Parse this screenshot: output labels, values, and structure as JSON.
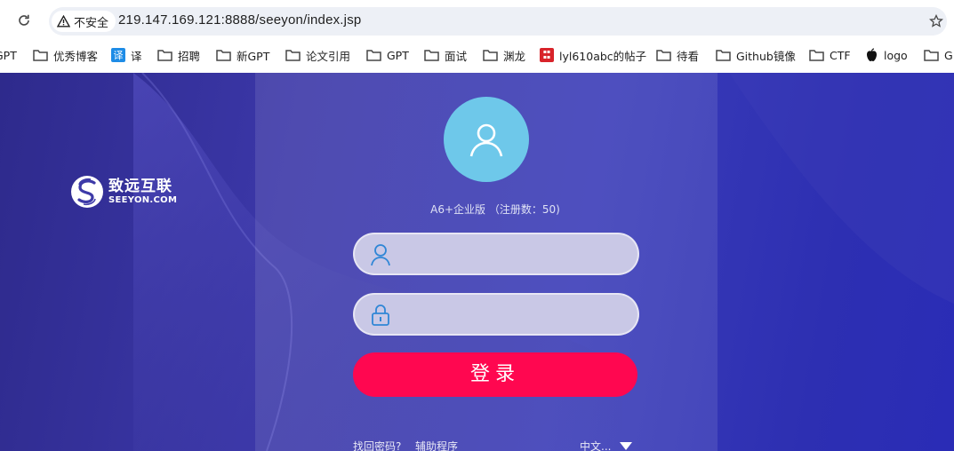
{
  "browser": {
    "security_label": "不安全",
    "url": "219.147.169.121:8888/seeyon/index.jsp"
  },
  "bookmarks": [
    {
      "label": "GPT",
      "icon": "folder-icon"
    },
    {
      "label": "优秀博客",
      "icon": "folder-icon"
    },
    {
      "label": "译",
      "icon": "translate-icon"
    },
    {
      "label": "招聘",
      "icon": "folder-icon"
    },
    {
      "label": "新GPT",
      "icon": "folder-icon"
    },
    {
      "label": "论文引用",
      "icon": "folder-icon"
    },
    {
      "label": "GPT",
      "icon": "folder-icon"
    },
    {
      "label": "面试",
      "icon": "folder-icon"
    },
    {
      "label": "渊龙",
      "icon": "folder-icon"
    },
    {
      "label": "lyl610abc的帖子",
      "icon": "seal-icon"
    },
    {
      "label": "待看",
      "icon": "folder-icon"
    },
    {
      "label": "Github镜像",
      "icon": "folder-icon"
    },
    {
      "label": "CTF",
      "icon": "folder-icon"
    },
    {
      "label": "logo",
      "icon": "apple-icon"
    },
    {
      "label": "G",
      "icon": "folder-icon"
    }
  ],
  "colors": {
    "accent": "#ff0750",
    "avatar_bg": "#6ec8ea",
    "page_bg": "#3a3cb8"
  },
  "brand": {
    "name_cn": "致远互联",
    "name_en": "SEEYON.COM"
  },
  "login": {
    "edition": "A6+企业版 （注册数：50)",
    "username_value": "",
    "password_value": "",
    "submit_label": "登录",
    "find_password": "找回密码?",
    "helper_program": "辅助程序",
    "language": "中文..."
  }
}
